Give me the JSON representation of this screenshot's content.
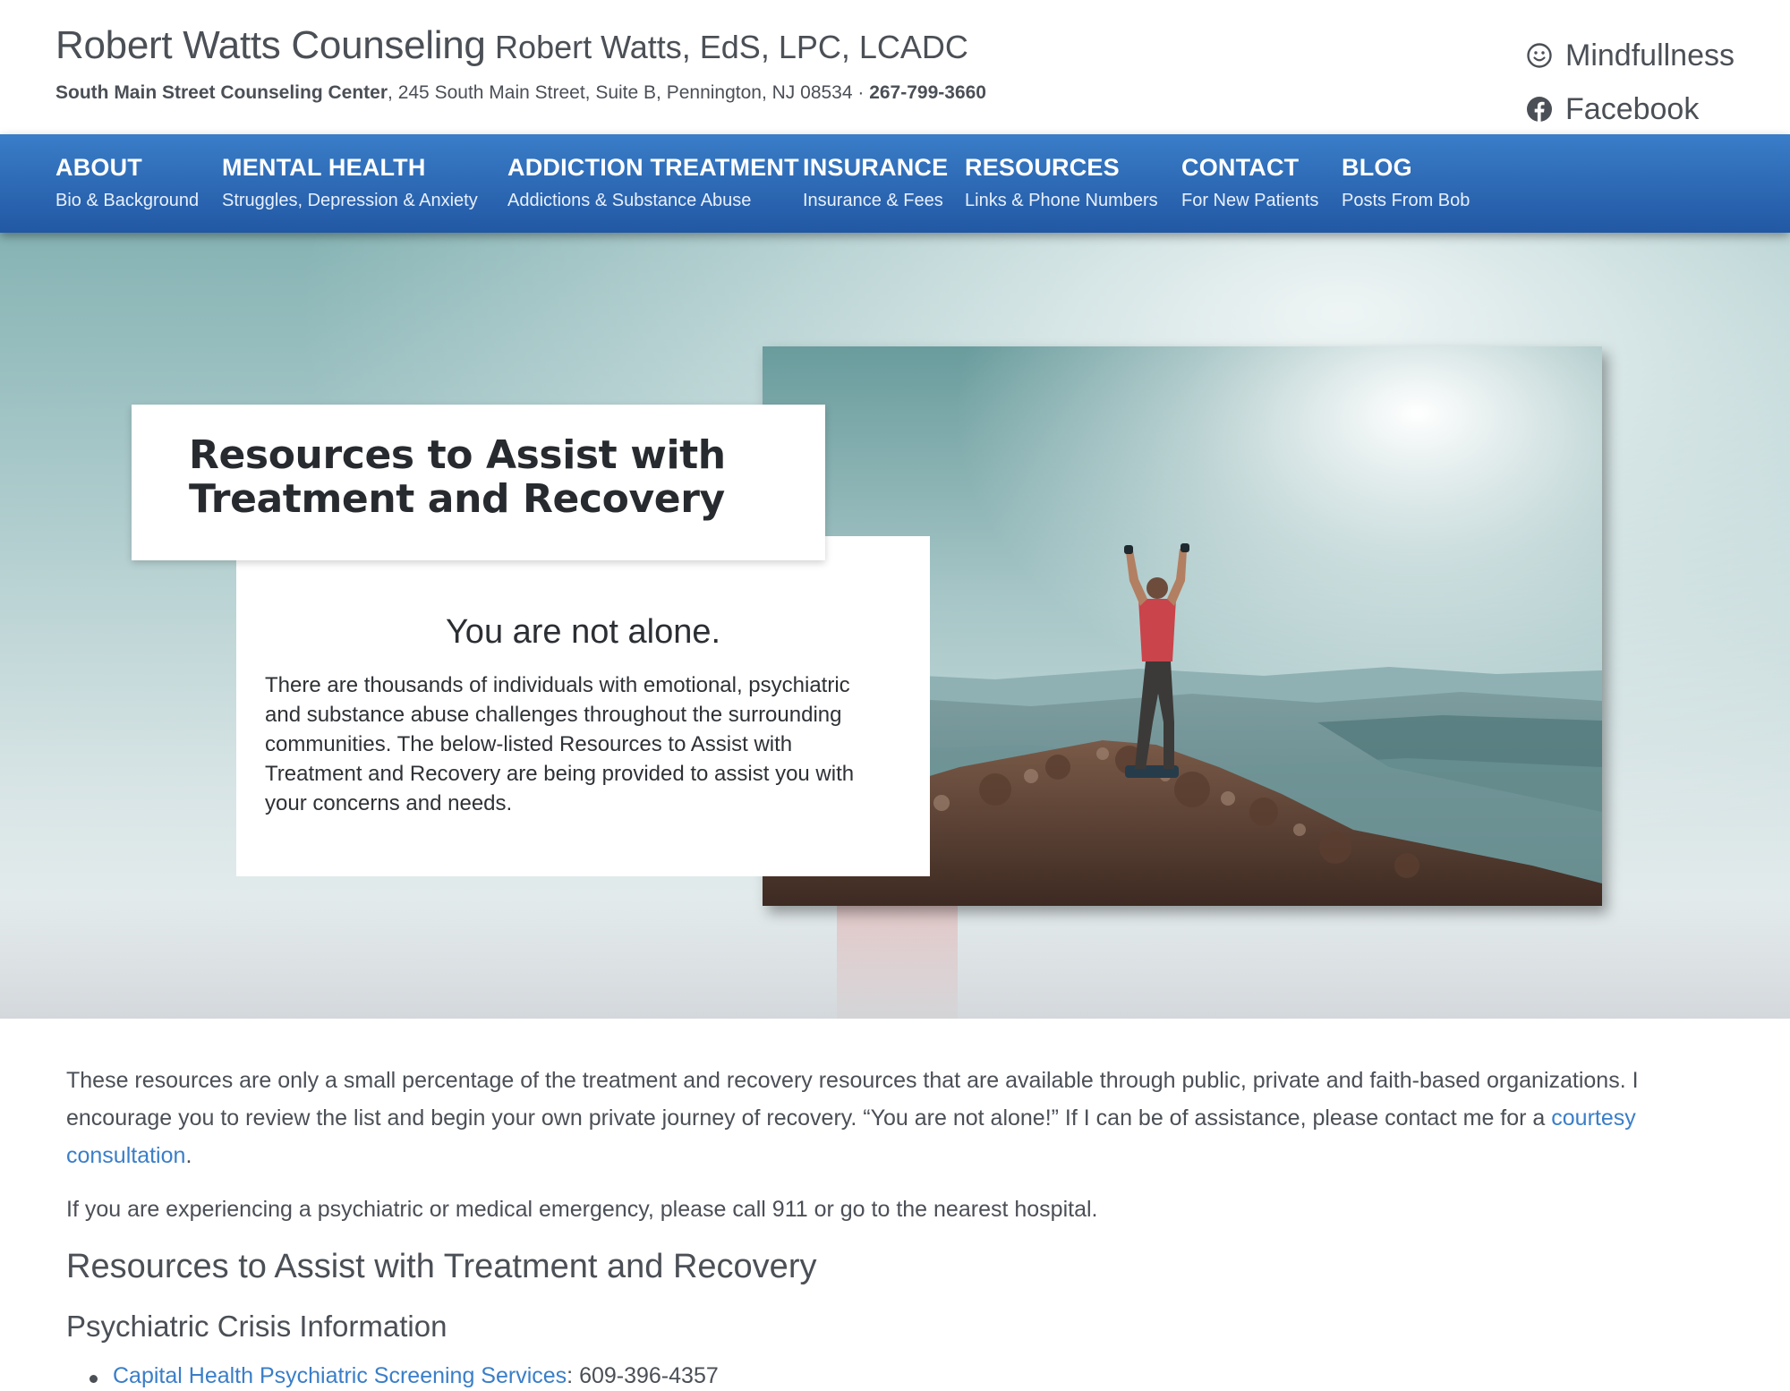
{
  "header": {
    "practice_name": "Robert Watts Counseling",
    "credentials": "Robert Watts, EdS, LPC, LCADC",
    "center_name": "South Main Street Counseling Center",
    "address": ", 245 South Main Street, Suite B, Pennington, NJ 08534 · ",
    "phone": "267-799-3660",
    "links": [
      {
        "label": "Mindfullness",
        "icon": "smiley-icon"
      },
      {
        "label": "Facebook",
        "icon": "facebook-icon"
      }
    ]
  },
  "nav": {
    "items": [
      {
        "title": "ABOUT",
        "subtitle": "Bio & Background"
      },
      {
        "title": "MENTAL HEALTH",
        "subtitle": "Struggles, Depression & Anxiety"
      },
      {
        "title": "ADDICTION TREATMENT",
        "subtitle": "Addictions & Substance Abuse"
      },
      {
        "title": "INSURANCE",
        "subtitle": "Insurance & Fees"
      },
      {
        "title": "RESOURCES",
        "subtitle": "Links & Phone Numbers"
      },
      {
        "title": "CONTACT",
        "subtitle": "For New Patients"
      },
      {
        "title": "BLOG",
        "subtitle": "Posts From Bob"
      }
    ]
  },
  "hero": {
    "title": "Resources to Assist with Treatment and Recovery",
    "subtitle": "You are not alone.",
    "body": "There are thousands of individuals with emotional, psychiatric and substance abuse challenges throughout the surrounding communities. The below-listed Resources to Assist with Treatment and Recovery are being provided to assist you with your concerns and needs."
  },
  "content": {
    "intro_text": "These resources are only a small percentage of the treatment and recovery resources that are available through public, private and faith-based organizations. I encourage you to review the list and begin your own private journey of recovery. “You are not alone!” If I can be of assistance, please contact me for a ",
    "intro_link": "courtesy consultation",
    "intro_end": ".",
    "emergency_text": "If you are experiencing a psychiatric or medical emergency, please call 911 or go to the nearest hospital.",
    "section_heading": "Resources to Assist with Treatment and Recovery",
    "subsection_heading": "Psychiatric Crisis Information",
    "resources": [
      {
        "name": "Capital Health Psychiatric Screening Services",
        "phone": ": 609-396-4357"
      }
    ]
  },
  "colors": {
    "nav_top": "#3a7dc8",
    "nav_bottom": "#2258a4",
    "link": "#3a7ec8",
    "text": "#4b4f56"
  }
}
